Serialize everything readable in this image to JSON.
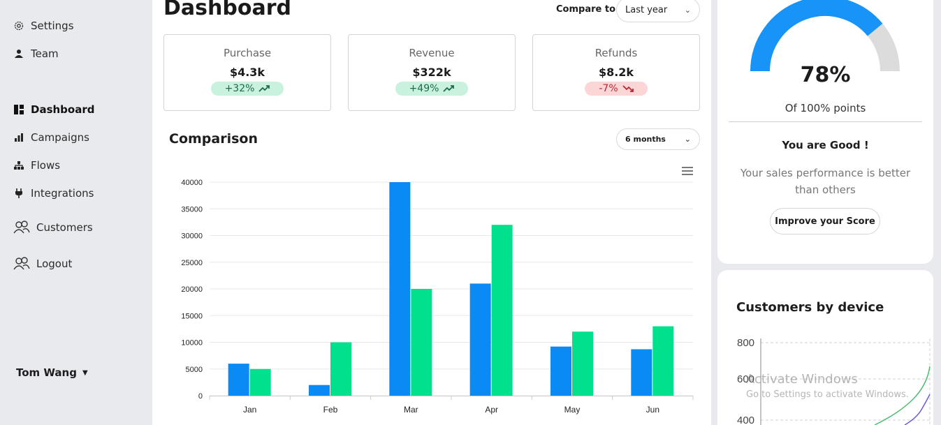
{
  "sidebar": {
    "items": [
      {
        "label": "Settings",
        "icon": "gear-icon"
      },
      {
        "label": "Team",
        "icon": "person-icon"
      },
      {
        "label": "Dashboard",
        "icon": "dashboard-icon",
        "active": true
      },
      {
        "label": "Campaigns",
        "icon": "bar-chart-icon"
      },
      {
        "label": "Flows",
        "icon": "flow-icon"
      },
      {
        "label": "Integrations",
        "icon": "plug-icon"
      },
      {
        "label": "Customers",
        "icon": "users-icon"
      },
      {
        "label": "Logout",
        "icon": "users-icon"
      }
    ],
    "user": "Tom Wang"
  },
  "header": {
    "title": "Dashboard",
    "compare_label": "Compare to",
    "compare_value": "Last year"
  },
  "cards": [
    {
      "label": "Purchase",
      "value": "$4.3k",
      "change": "+32%",
      "trend": "up"
    },
    {
      "label": "Revenue",
      "value": "$322k",
      "change": "+49%",
      "trend": "up"
    },
    {
      "label": "Refunds",
      "value": "$8.2k",
      "change": "-7%",
      "trend": "down"
    }
  ],
  "comparison": {
    "title": "Comparison",
    "period": "6 months"
  },
  "chart_data": {
    "type": "bar",
    "categories": [
      "Jan",
      "Feb",
      "Mar",
      "Apr",
      "May",
      "Jun"
    ],
    "series": [
      {
        "values": [
          6000,
          2000,
          40000,
          21000,
          9200,
          8700
        ],
        "color": "#0a8af5"
      },
      {
        "values": [
          5000,
          10000,
          20000,
          32000,
          12000,
          13000
        ],
        "color": "#00e08d"
      }
    ],
    "ylim": [
      0,
      40000
    ],
    "yticks": [
      0,
      5000,
      10000,
      15000,
      20000,
      25000,
      30000,
      35000,
      40000
    ],
    "grid": true
  },
  "score": {
    "percent": "78%",
    "value": 0.78,
    "subtitle": "Of 100% points",
    "heading": "You are Good !",
    "message": "Your sales performance is better than others",
    "button": "Improve your Score",
    "colors": {
      "fill": "#1893f8",
      "rest": "#dcdcdc"
    }
  },
  "devices": {
    "title": "Customers by device",
    "yticks": [
      "800",
      "600",
      "400"
    ]
  },
  "watermark": {
    "line1": "Activate Windows",
    "line2": "Go to Settings to activate Windows."
  }
}
